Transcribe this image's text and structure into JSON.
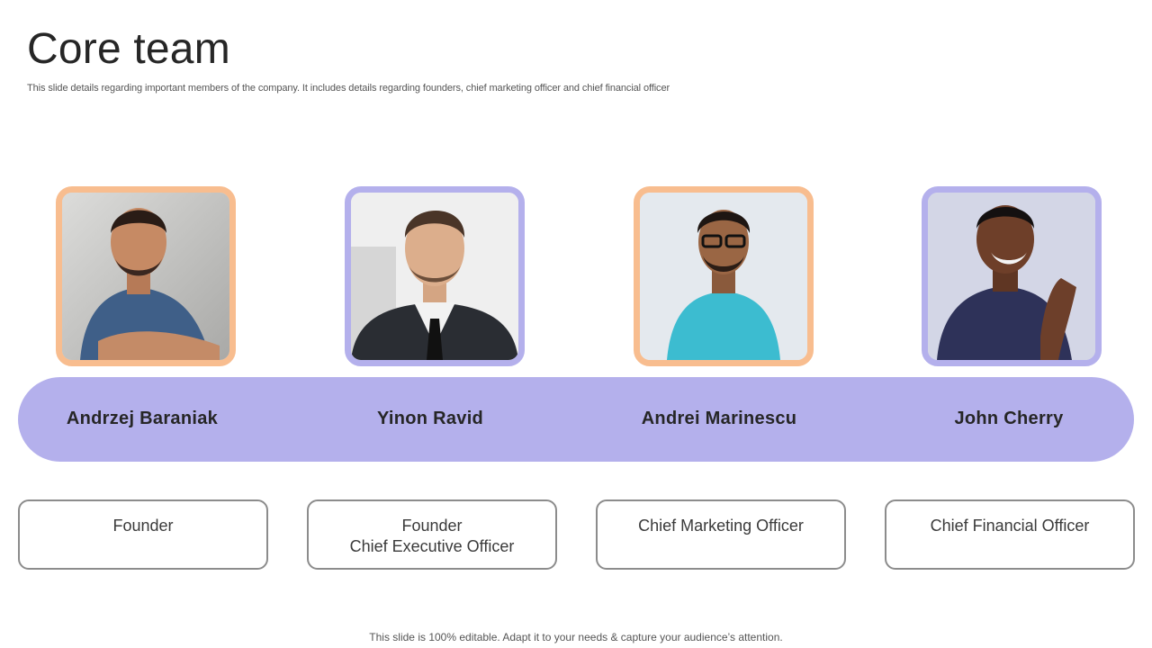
{
  "slide": {
    "title": "Core team",
    "subtitle": "This slide details regarding important members of the company. It includes details regarding founders, chief marketing officer and chief financial officer",
    "footer": "This slide is 100% editable. Adapt it to your needs & capture your audience’s attention."
  },
  "colors": {
    "band": "#b4b0ec",
    "peach": "#f8bd8f",
    "lavender": "#b4b0ec",
    "box_border": "#8c8c8c"
  },
  "team": [
    {
      "name": "Andrzej Baraniak",
      "roles": [
        "Founder"
      ],
      "frame_color": "peach",
      "photo_icon": "person-photo-icon"
    },
    {
      "name": "Yinon Ravid",
      "roles": [
        "Founder",
        "Chief Executive Officer"
      ],
      "frame_color": "lavender",
      "photo_icon": "person-photo-icon"
    },
    {
      "name": "Andrei Marinescu",
      "roles": [
        "Chief Marketing Officer"
      ],
      "frame_color": "peach",
      "photo_icon": "person-photo-icon"
    },
    {
      "name": "John Cherry",
      "roles": [
        "Chief Financial Officer"
      ],
      "frame_color": "lavender",
      "photo_icon": "person-photo-icon"
    }
  ]
}
